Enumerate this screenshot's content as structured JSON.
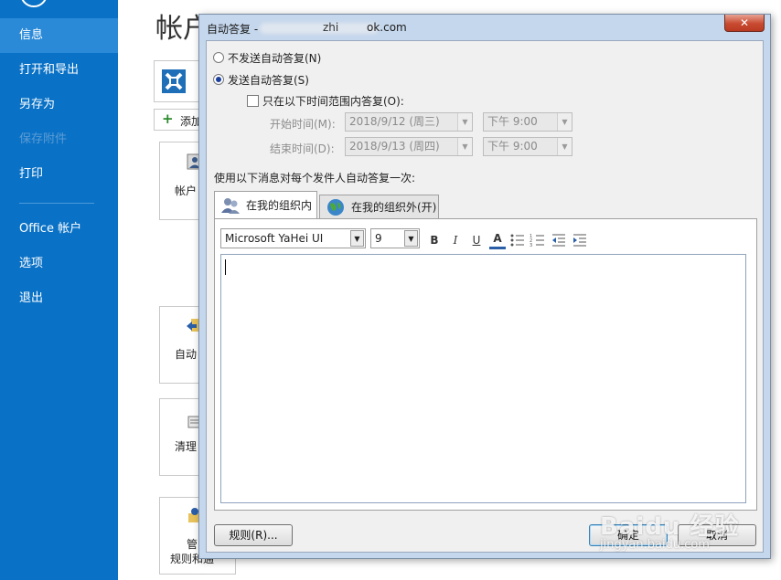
{
  "sidebar": {
    "items": [
      {
        "label": "信息"
      },
      {
        "label": "打开和导出"
      },
      {
        "label": "另存为"
      },
      {
        "label": "保存附件"
      },
      {
        "label": "打印"
      },
      {
        "label": "Office 帐户"
      },
      {
        "label": "选项"
      },
      {
        "label": "退出"
      }
    ]
  },
  "background": {
    "page_title": "帐户",
    "add_account": "添加",
    "tiles": [
      "帐户",
      "自动",
      "清理",
      "管",
      "规则和通"
    ]
  },
  "dialog": {
    "title_prefix": "自动答复 - ",
    "title_suffix": "ok.com",
    "title_partial": "zhi",
    "close_label": "✕",
    "options": {
      "no_send": "不发送自动答复(N)",
      "send": "发送自动答复(S)",
      "time_range": "只在以下时间范围内答复(O):"
    },
    "start": {
      "label": "开始时间(M):",
      "date": "2018/9/12 (周三)",
      "time": "下午 9:00"
    },
    "end": {
      "label": "结束时间(D):",
      "date": "2018/9/13 (周四)",
      "time": "下午 9:00"
    },
    "message_label": "使用以下消息对每个发件人自动答复一次:",
    "tabs": [
      {
        "label": "在我的组织内",
        "active": true
      },
      {
        "label": "在我的组织外(开)",
        "active": false
      }
    ],
    "font_name": "Microsoft YaHei UI",
    "font_size": "9",
    "format_buttons": [
      "B",
      "I",
      "U",
      "A"
    ],
    "rules_button": "规则(R)...",
    "ok_button": "确定",
    "cancel_button": "取消"
  },
  "watermark": {
    "main": "Baidu 经验",
    "sub": "jingyan.baidu.com"
  },
  "colors": {
    "backstage_blue": "#0a72c6",
    "backstage_active": "#2a8ad8",
    "dialog_frame": "#c5d7ec",
    "close_red": "#c84a30"
  }
}
